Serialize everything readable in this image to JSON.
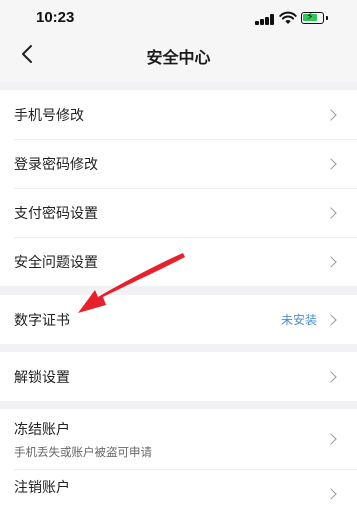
{
  "status_bar": {
    "time": "10:23"
  },
  "header": {
    "title": "安全中心"
  },
  "groups": [
    {
      "items": [
        {
          "label": "手机号修改"
        },
        {
          "label": "登录密码修改"
        },
        {
          "label": "支付密码设置"
        },
        {
          "label": "安全问题设置"
        }
      ]
    },
    {
      "items": [
        {
          "label": "数字证书",
          "value": "未安装"
        }
      ]
    },
    {
      "items": [
        {
          "label": "解锁设置"
        }
      ]
    },
    {
      "items": [
        {
          "label": "冻结账户",
          "sub": "手机丢失或账户被盗可申请"
        },
        {
          "label": "注销账户"
        }
      ]
    }
  ],
  "annotation": {
    "arrow_color": "#e8202c",
    "icon": "red-arrow-pointer-icon"
  }
}
